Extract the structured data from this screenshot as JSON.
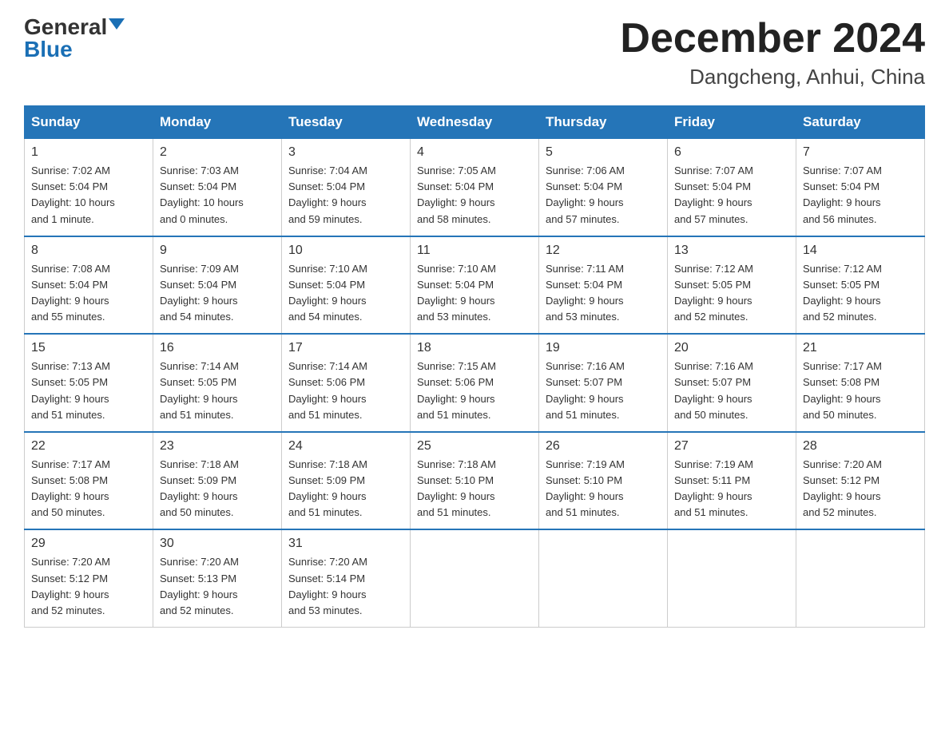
{
  "header": {
    "logo_general": "General",
    "logo_blue": "Blue",
    "month_title": "December 2024",
    "location": "Dangcheng, Anhui, China"
  },
  "weekdays": [
    "Sunday",
    "Monday",
    "Tuesday",
    "Wednesday",
    "Thursday",
    "Friday",
    "Saturday"
  ],
  "weeks": [
    [
      {
        "day": "1",
        "info": "Sunrise: 7:02 AM\nSunset: 5:04 PM\nDaylight: 10 hours\nand 1 minute."
      },
      {
        "day": "2",
        "info": "Sunrise: 7:03 AM\nSunset: 5:04 PM\nDaylight: 10 hours\nand 0 minutes."
      },
      {
        "day": "3",
        "info": "Sunrise: 7:04 AM\nSunset: 5:04 PM\nDaylight: 9 hours\nand 59 minutes."
      },
      {
        "day": "4",
        "info": "Sunrise: 7:05 AM\nSunset: 5:04 PM\nDaylight: 9 hours\nand 58 minutes."
      },
      {
        "day": "5",
        "info": "Sunrise: 7:06 AM\nSunset: 5:04 PM\nDaylight: 9 hours\nand 57 minutes."
      },
      {
        "day": "6",
        "info": "Sunrise: 7:07 AM\nSunset: 5:04 PM\nDaylight: 9 hours\nand 57 minutes."
      },
      {
        "day": "7",
        "info": "Sunrise: 7:07 AM\nSunset: 5:04 PM\nDaylight: 9 hours\nand 56 minutes."
      }
    ],
    [
      {
        "day": "8",
        "info": "Sunrise: 7:08 AM\nSunset: 5:04 PM\nDaylight: 9 hours\nand 55 minutes."
      },
      {
        "day": "9",
        "info": "Sunrise: 7:09 AM\nSunset: 5:04 PM\nDaylight: 9 hours\nand 54 minutes."
      },
      {
        "day": "10",
        "info": "Sunrise: 7:10 AM\nSunset: 5:04 PM\nDaylight: 9 hours\nand 54 minutes."
      },
      {
        "day": "11",
        "info": "Sunrise: 7:10 AM\nSunset: 5:04 PM\nDaylight: 9 hours\nand 53 minutes."
      },
      {
        "day": "12",
        "info": "Sunrise: 7:11 AM\nSunset: 5:04 PM\nDaylight: 9 hours\nand 53 minutes."
      },
      {
        "day": "13",
        "info": "Sunrise: 7:12 AM\nSunset: 5:05 PM\nDaylight: 9 hours\nand 52 minutes."
      },
      {
        "day": "14",
        "info": "Sunrise: 7:12 AM\nSunset: 5:05 PM\nDaylight: 9 hours\nand 52 minutes."
      }
    ],
    [
      {
        "day": "15",
        "info": "Sunrise: 7:13 AM\nSunset: 5:05 PM\nDaylight: 9 hours\nand 51 minutes."
      },
      {
        "day": "16",
        "info": "Sunrise: 7:14 AM\nSunset: 5:05 PM\nDaylight: 9 hours\nand 51 minutes."
      },
      {
        "day": "17",
        "info": "Sunrise: 7:14 AM\nSunset: 5:06 PM\nDaylight: 9 hours\nand 51 minutes."
      },
      {
        "day": "18",
        "info": "Sunrise: 7:15 AM\nSunset: 5:06 PM\nDaylight: 9 hours\nand 51 minutes."
      },
      {
        "day": "19",
        "info": "Sunrise: 7:16 AM\nSunset: 5:07 PM\nDaylight: 9 hours\nand 51 minutes."
      },
      {
        "day": "20",
        "info": "Sunrise: 7:16 AM\nSunset: 5:07 PM\nDaylight: 9 hours\nand 50 minutes."
      },
      {
        "day": "21",
        "info": "Sunrise: 7:17 AM\nSunset: 5:08 PM\nDaylight: 9 hours\nand 50 minutes."
      }
    ],
    [
      {
        "day": "22",
        "info": "Sunrise: 7:17 AM\nSunset: 5:08 PM\nDaylight: 9 hours\nand 50 minutes."
      },
      {
        "day": "23",
        "info": "Sunrise: 7:18 AM\nSunset: 5:09 PM\nDaylight: 9 hours\nand 50 minutes."
      },
      {
        "day": "24",
        "info": "Sunrise: 7:18 AM\nSunset: 5:09 PM\nDaylight: 9 hours\nand 51 minutes."
      },
      {
        "day": "25",
        "info": "Sunrise: 7:18 AM\nSunset: 5:10 PM\nDaylight: 9 hours\nand 51 minutes."
      },
      {
        "day": "26",
        "info": "Sunrise: 7:19 AM\nSunset: 5:10 PM\nDaylight: 9 hours\nand 51 minutes."
      },
      {
        "day": "27",
        "info": "Sunrise: 7:19 AM\nSunset: 5:11 PM\nDaylight: 9 hours\nand 51 minutes."
      },
      {
        "day": "28",
        "info": "Sunrise: 7:20 AM\nSunset: 5:12 PM\nDaylight: 9 hours\nand 52 minutes."
      }
    ],
    [
      {
        "day": "29",
        "info": "Sunrise: 7:20 AM\nSunset: 5:12 PM\nDaylight: 9 hours\nand 52 minutes."
      },
      {
        "day": "30",
        "info": "Sunrise: 7:20 AM\nSunset: 5:13 PM\nDaylight: 9 hours\nand 52 minutes."
      },
      {
        "day": "31",
        "info": "Sunrise: 7:20 AM\nSunset: 5:14 PM\nDaylight: 9 hours\nand 53 minutes."
      },
      {
        "day": "",
        "info": ""
      },
      {
        "day": "",
        "info": ""
      },
      {
        "day": "",
        "info": ""
      },
      {
        "day": "",
        "info": ""
      }
    ]
  ]
}
